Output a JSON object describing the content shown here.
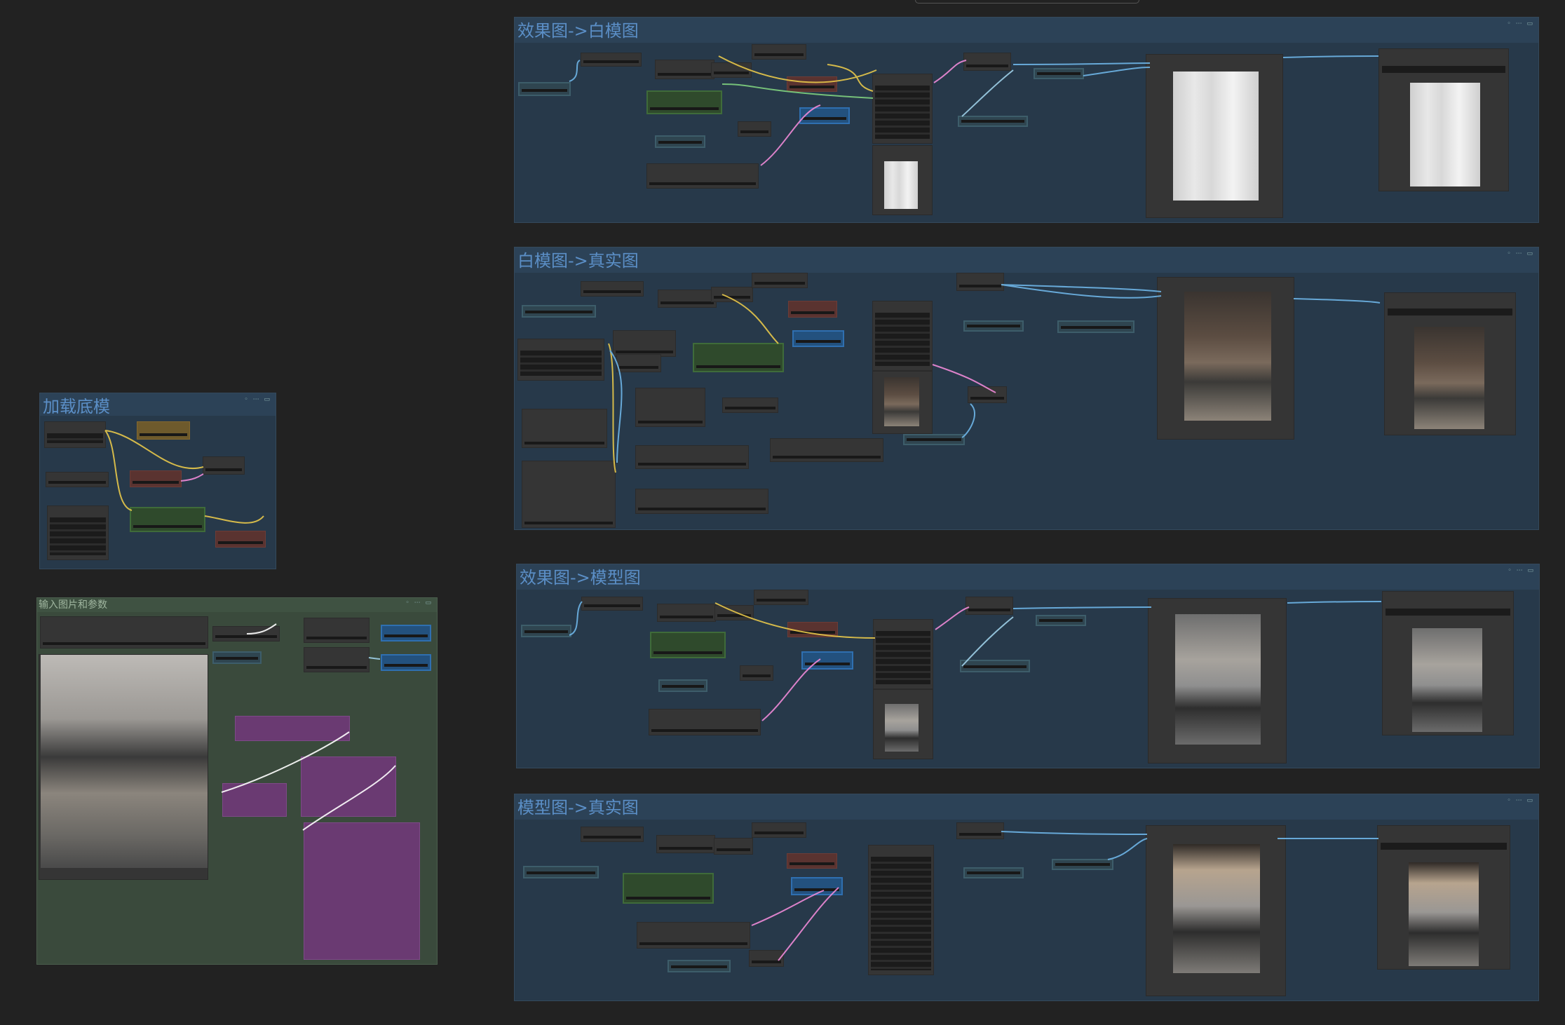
{
  "canvas": {
    "background": "#222222"
  },
  "groups": [
    {
      "title": "效果图->白模图",
      "color": "#27394a",
      "images": [
        "white-render",
        "white-render"
      ]
    },
    {
      "title": "白模图->真实图",
      "color": "#27394a",
      "images": [
        "realistic-render",
        "realistic-render"
      ]
    },
    {
      "title": "效果图->模型图",
      "color": "#27394a",
      "images": [
        "model-render",
        "model-render"
      ]
    },
    {
      "title": "模型图->真实图",
      "color": "#27394a",
      "images": [
        "realistic-render",
        "realistic-render"
      ]
    },
    {
      "title": "加载底模",
      "color": "#27394a"
    },
    {
      "title": "输入图片和参数",
      "color": "#3a4a3c",
      "images": [
        "input-living-room"
      ]
    }
  ],
  "wire_colors": {
    "image": "#6fb6e8",
    "model": "#e8c84a",
    "latent": "#f08ad8",
    "vae": "#e05a5a",
    "clip": "#e8c84a",
    "mask": "#7fd07f"
  },
  "header_icons": "◦ ⋯ ▭"
}
